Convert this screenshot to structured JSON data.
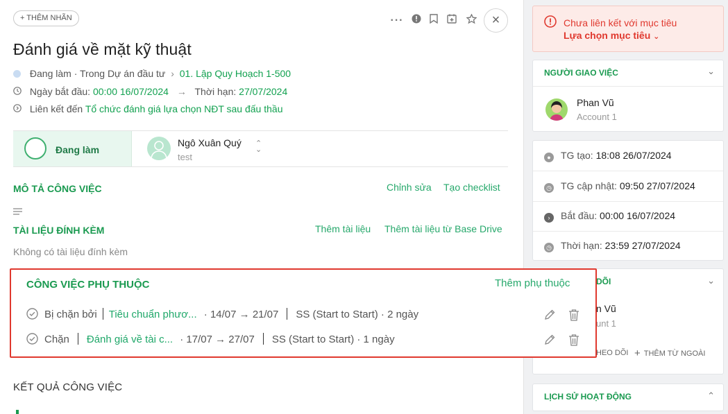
{
  "header": {
    "add_label": "THÊM NHÃN",
    "title": "Đánh giá về mặt kỹ thuật"
  },
  "meta": {
    "status_project": "Đang làm · Trong Dự án đầu tư",
    "project_link": "01. Lập Quy Hoạch 1-500",
    "start_label": "Ngày bắt đầu:",
    "start_value": "00:00 16/07/2024",
    "deadline_label": "Thời hạn:",
    "deadline_value": "27/07/2024",
    "linked_label": "Liên kết đến",
    "linked_link": "Tổ chức đánh giá lựa chọn NĐT sau đấu thầu"
  },
  "status_bar": {
    "status": "Đang làm",
    "assignee_name": "Ngô Xuân Quý",
    "assignee_account": "test"
  },
  "description": {
    "title": "MÔ TẢ CÔNG VIỆC",
    "edit": "Chỉnh sửa",
    "checklist": "Tạo checklist"
  },
  "attachments": {
    "title": "TÀI LIỆU ĐÍNH KÈM",
    "add": "Thêm tài liệu",
    "add_drive": "Thêm tài liệu từ Base Drive",
    "empty": "Không có tài liệu đính kèm"
  },
  "dependencies": {
    "title": "CÔNG VIỆC PHỤ THUỘC",
    "add": "Thêm phụ thuộc",
    "rows": [
      {
        "relation": "Bị chặn bởi",
        "task": "Tiêu chuẩn phươ...",
        "dates": "· 14/07 → 21/07",
        "type": "SS (Start to Start) · 2 ngày"
      },
      {
        "relation": "Chặn",
        "task": "Đánh giá về tài c...",
        "dates": "· 17/07 → 27/07",
        "type": "SS (Start to Start) · 1 ngày"
      }
    ]
  },
  "result": {
    "title": "KẾT QUẢ CÔNG VIỆC"
  },
  "right": {
    "goal_warning": "Chưa liên kết với mục tiêu",
    "goal_select": "Lựa chọn mục tiêu",
    "assigner_title": "NGƯỜI GIAO VIỆC",
    "assigner_name": "Phan Vũ",
    "assigner_account": "Account 1",
    "created_label": "TG tạo:",
    "created_value": "18:08 26/07/2024",
    "updated_label": "TG cập nhật:",
    "updated_value": "09:50 27/07/2024",
    "start_label": "Bắt đầu:",
    "start_value": "00:00 16/07/2024",
    "deadline_label": "Thời hạn:",
    "deadline_value": "23:59 27/07/2024",
    "followers_title_tail": "DÕI",
    "follower_name_tail": "n Vũ",
    "follower_account_tail": "unt 1",
    "follow_tail": "HEO DÕI",
    "add_external": "THÊM TỪ NGOÀI",
    "history_title": "LỊCH SỬ HOẠT ĐỘNG"
  },
  "colors": {
    "accent": "#1a9a50",
    "link": "#12a150",
    "highlight_border": "#e0382e",
    "warning_bg": "#fdebe8",
    "warning_text": "#e0382e"
  }
}
